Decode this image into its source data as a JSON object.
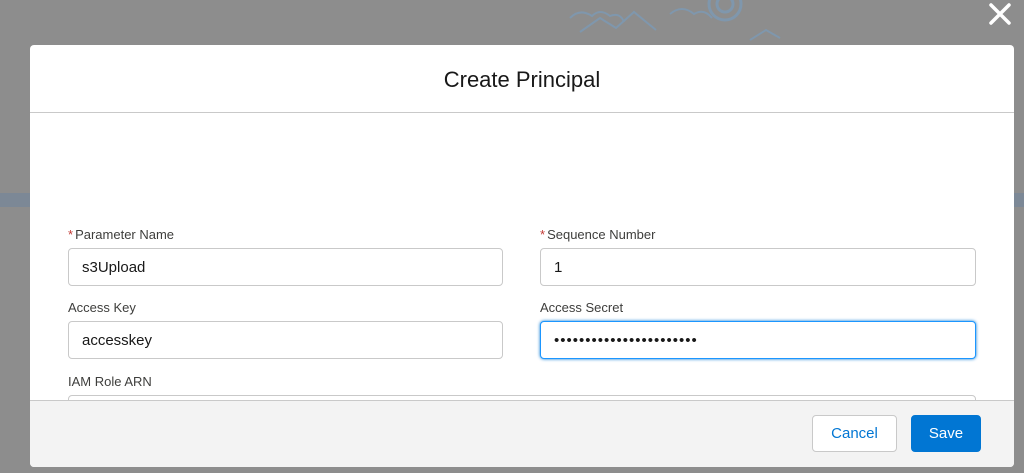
{
  "modal": {
    "title": "Create Principal"
  },
  "form": {
    "parameter_name": {
      "label": "Parameter Name",
      "required_marker": "*",
      "value": "s3Upload"
    },
    "sequence_number": {
      "label": "Sequence Number",
      "required_marker": "*",
      "value": "1"
    },
    "access_key": {
      "label": "Access Key",
      "value": "accesskey"
    },
    "access_secret": {
      "label": "Access Secret",
      "value": "•••••••••••••••••••••••"
    },
    "iam_role_arn": {
      "label": "IAM Role ARN",
      "value": ""
    }
  },
  "footer": {
    "cancel_label": "Cancel",
    "save_label": "Save"
  },
  "icons": {
    "close": "close-icon"
  },
  "colors": {
    "brand": "#0176d3",
    "required": "#c23934",
    "focus_border": "#1b96ff",
    "overlay": "#8d8d8d"
  }
}
